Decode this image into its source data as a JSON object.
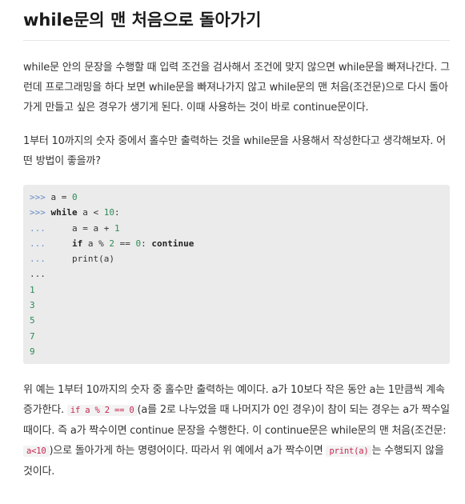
{
  "title": "while문의 맨 처음으로 돌아가기",
  "para1": "while문 안의 문장을 수행할 때 입력 조건을 검사해서 조건에 맞지 않으면 while문을 빠져나간다. 그런데 프로그래밍을 하다 보면 while문을 빠져나가지 않고 while문의 맨 처음(조건문)으로 다시 돌아가게 만들고 싶은 경우가 생기게 된다. 이때 사용하는 것이 바로 continue문이다.",
  "para2": "1부터 10까지의 숫자 중에서 홀수만 출력하는 것을 while문을 사용해서 작성한다고 생각해보자. 어떤 방법이 좋을까?",
  "code": {
    "prompt": ">>>",
    "cont": "...",
    "l1_a": "a = ",
    "l1_n": "0",
    "l2_kw": "while",
    "l2_a": " a < ",
    "l2_n": "10",
    "l2_b": ":",
    "l3_a": "a = a + ",
    "l3_n": "1",
    "l4_kw": "if",
    "l4_a": " a % ",
    "l4_n1": "2",
    "l4_b": " == ",
    "l4_n2": "0",
    "l4_c": ": ",
    "l4_kw2": "continue",
    "l5": "print(a)",
    "outputs": [
      "1",
      "3",
      "5",
      "7",
      "9"
    ]
  },
  "para3": {
    "t1": "위 예는 1부터 10까지의 숫자 중 홀수만 출력하는 예이다. a가 10보다 작은 동안 a는 1만큼씩 계속 증가한다. ",
    "c1": "if a % 2 == 0",
    "t2": "(a를 2로 나누었을 때 나머지가 0인 경우)이 참이 되는 경우는 a가 짝수일 때이다. 즉 a가 짝수이면 continue 문장을 수행한다. 이 continue문은 while문의 맨 처음(조건문: ",
    "c2": "a<10",
    "t3": ")으로 돌아가게 하는 명령어이다. 따라서 위 예에서 a가 짝수이면 ",
    "c3": "print(a)",
    "t4": "는 수행되지 않을 것이다."
  }
}
